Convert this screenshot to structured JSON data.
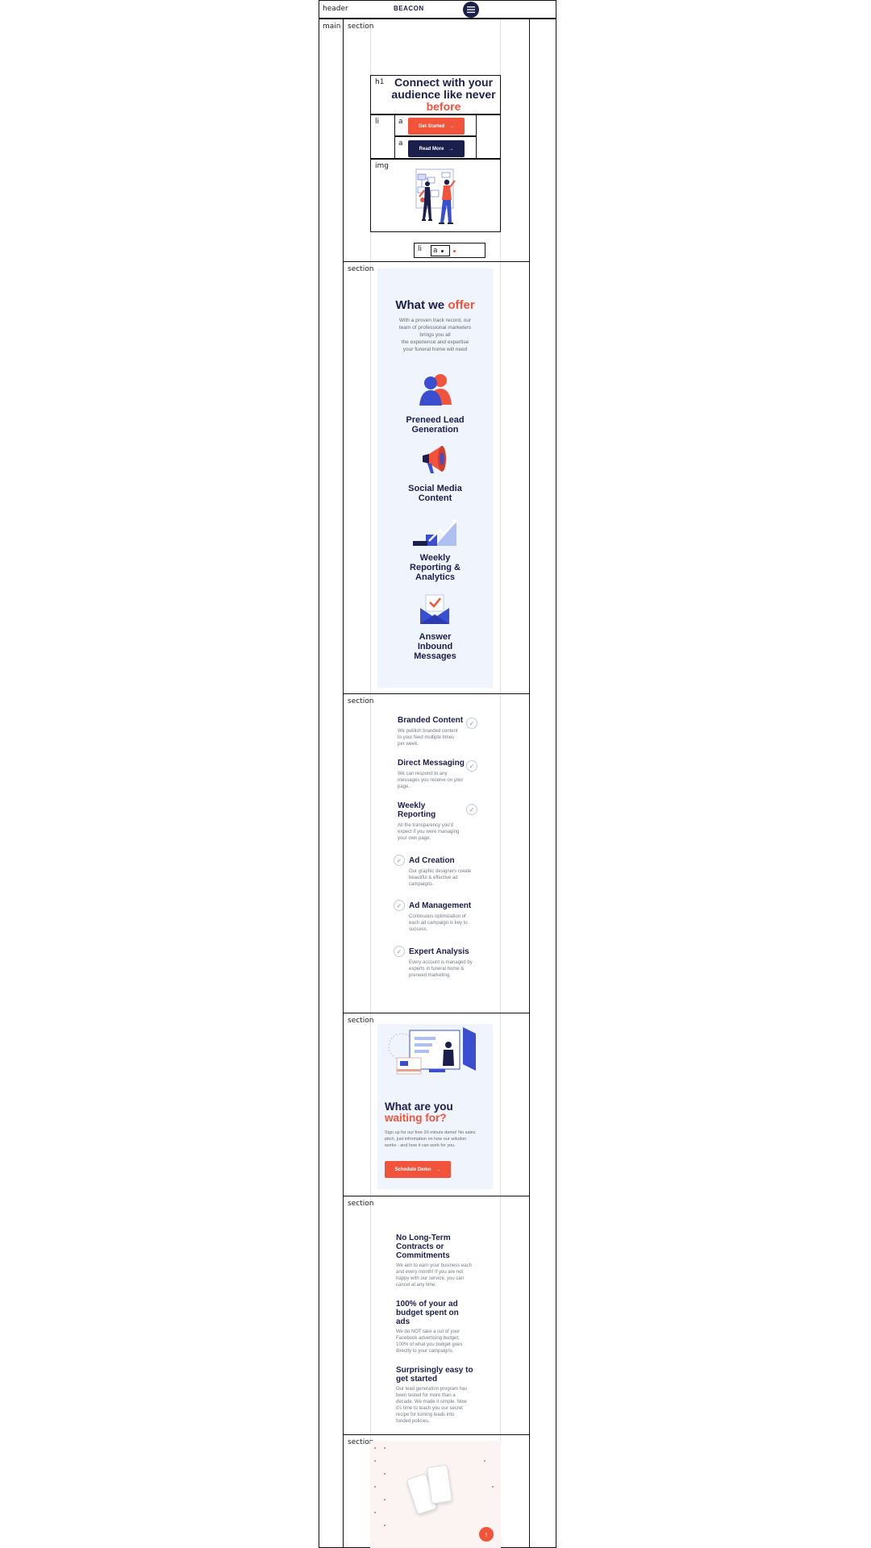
{
  "labels": {
    "header": "header",
    "main": "main",
    "section": "section",
    "h1": "h1",
    "li": "li",
    "a": "a",
    "img": "img"
  },
  "header": {
    "logo": "BEACON"
  },
  "hero": {
    "title_line1": "Connect with your",
    "title_line2": "audience like never",
    "title_highlight": "before",
    "get_started": "Get Started",
    "read_more": "Read More",
    "arrow": "→",
    "dots_link": "a"
  },
  "offer": {
    "title": "What we",
    "title_highlight": "offer",
    "desc_lines": [
      "With a proven track record, our",
      "team of professional marketers",
      "brings you all",
      "the experience and expertise",
      "your funeral home will need"
    ],
    "items": [
      {
        "lines": [
          "Preneed Lead",
          "Generation"
        ],
        "icon": "users-icon"
      },
      {
        "lines": [
          "Social Media",
          "Content"
        ],
        "icon": "megaphone-icon"
      },
      {
        "lines": [
          "Weekly",
          "Reporting &",
          "Analytics"
        ],
        "icon": "chart-icon"
      },
      {
        "lines": [
          "Answer",
          "Inbound",
          "Messages"
        ],
        "icon": "envelope-icon"
      }
    ]
  },
  "services": {
    "check": "✓",
    "left": [
      {
        "title_lines": [
          "Branded Content"
        ],
        "desc_lines": [
          "We publish branded content",
          "to your feed multiple times",
          "per week."
        ]
      },
      {
        "title_lines": [
          "Direct Messaging"
        ],
        "desc_lines": [
          "We can respond to any",
          "messages you receive on your",
          "page."
        ]
      },
      {
        "title_lines": [
          "Weekly",
          "Reporting"
        ],
        "desc_lines": [
          "All the transparency you'd",
          "expect if you were managing",
          "your own page."
        ]
      }
    ],
    "right": [
      {
        "title_lines": [
          "Ad Creation"
        ],
        "desc_lines": [
          "Our graphic designers create",
          "beautiful & effective ad",
          "campaigns."
        ]
      },
      {
        "title_lines": [
          "Ad Management"
        ],
        "desc_lines": [
          "Continuous optimization of",
          "each ad campaign is key to",
          "success."
        ]
      },
      {
        "title_lines": [
          "Expert Analysis"
        ],
        "desc_lines": [
          "Every account is managed by",
          "experts in funeral home &",
          "preneed marketing."
        ]
      }
    ]
  },
  "cta": {
    "title": "What are you",
    "title_highlight": "waiting for?",
    "desc_lines": [
      "Sign up for our free 20 minute demo! No sales",
      "pitch, just information on how our solution",
      "works - and how it can work for you."
    ],
    "button": "Schedule Demo",
    "arrow": "→"
  },
  "benefits": [
    {
      "title_lines": [
        "No Long-Term",
        "Contracts or",
        "Commitments"
      ],
      "desc_lines": [
        "We aim to earn your business each",
        "and every month! If you are not",
        "happy with our service, you can",
        "cancel at any time."
      ]
    },
    {
      "title_lines": [
        "100% of your ad",
        "budget spent on",
        "ads"
      ],
      "desc_lines": [
        "We do NOT take a cut of your",
        "Facebook advertising budget;",
        "100% of what you budget goes",
        "directly to your campaigns."
      ]
    },
    {
      "title_lines": [
        "Surprisingly easy to",
        "get started"
      ],
      "desc_lines": [
        "Our lead generation program has",
        "been tested for more than a",
        "decade. We made it simple. Now",
        "it's time to teach you our secret",
        "recipe for turning leads into",
        "funded policies."
      ]
    }
  ],
  "scroll_top": "↑",
  "colors": {
    "accent": "#f2533b",
    "navy": "#1b1f4b",
    "panel": "#f0f4fd",
    "blue": "#3a4fd0"
  }
}
